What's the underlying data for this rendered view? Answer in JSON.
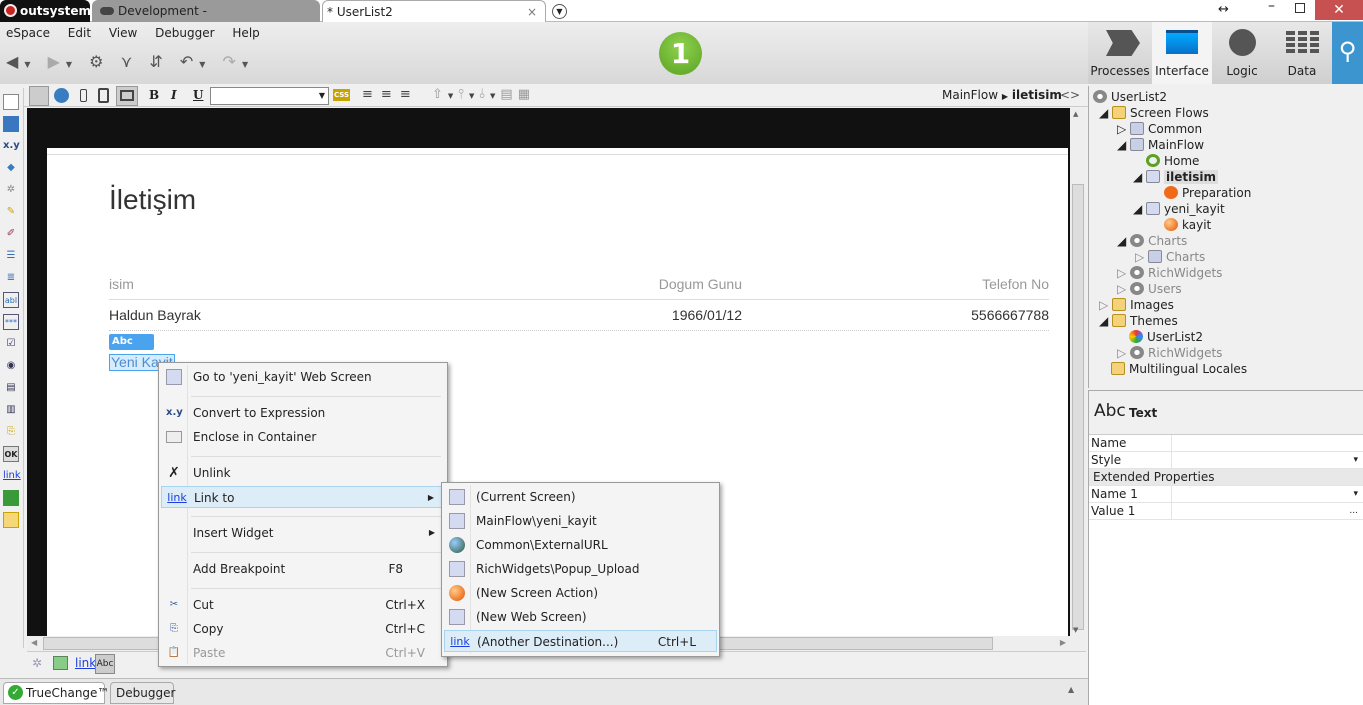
{
  "titlebar": {
    "brand": "outsystems",
    "tabs": [
      "Development - boa.outsystemscl...",
      "* UserList2"
    ],
    "close_tab": "×"
  },
  "menu": [
    "eSpace",
    "Edit",
    "View",
    "Debugger",
    "Help"
  ],
  "step_badge": "1",
  "right_tabs": [
    {
      "label": "Processes"
    },
    {
      "label": "Interface",
      "selected": true
    },
    {
      "label": "Logic"
    },
    {
      "label": "Data"
    }
  ],
  "canvas_toolbar": {
    "bold": "B",
    "italic": "I",
    "underline": "U",
    "css": "CSS",
    "style_value": "",
    "breadcrumb_flow": "MainFlow",
    "breadcrumb_screen": "iletisim",
    "toggle": "<>"
  },
  "left_toolbar": [
    "x.y",
    "abl",
    "OK",
    "link"
  ],
  "page": {
    "title": "İletişim",
    "table": {
      "headers": [
        "isim",
        "Dogum Gunu",
        "Telefon No"
      ],
      "rows": [
        [
          "Haldun Bayrak",
          "1966/01/12",
          "5566667788"
        ]
      ]
    },
    "widget_badge": "Abc Text",
    "link_text": "Yeni Kayit"
  },
  "context_menu": {
    "items": [
      {
        "label": "Go to 'yeni_kayit' Web Screen",
        "shortcut": ""
      },
      {
        "label": "Convert to Expression",
        "shortcut": ""
      },
      {
        "label": "Enclose in Container",
        "shortcut": ""
      },
      {
        "label": "Unlink",
        "shortcut": ""
      },
      {
        "label": "Link to",
        "shortcut": ""
      },
      {
        "label": "Insert Widget",
        "shortcut": ""
      },
      {
        "label": "Add Breakpoint",
        "shortcut": "F8"
      },
      {
        "label": "Cut",
        "shortcut": "Ctrl+X"
      },
      {
        "label": "Copy",
        "shortcut": "Ctrl+C"
      },
      {
        "label": "Paste",
        "shortcut": "Ctrl+V"
      }
    ],
    "xy_icon": "x.y",
    "link_icon": "link"
  },
  "submenu": {
    "items": [
      {
        "label": "(Current Screen)",
        "shortcut": ""
      },
      {
        "label": "MainFlow\\yeni_kayit",
        "shortcut": ""
      },
      {
        "label": "Common\\ExternalURL",
        "shortcut": ""
      },
      {
        "label": "RichWidgets\\Popup_Upload",
        "shortcut": ""
      },
      {
        "label": "(New Screen Action)",
        "shortcut": ""
      },
      {
        "label": "(New Web Screen)",
        "shortcut": ""
      },
      {
        "label": "(Another Destination...)",
        "shortcut": "Ctrl+L"
      }
    ]
  },
  "bottom_strip": {
    "link": "link",
    "abc": "Abc"
  },
  "bottom_tabs": [
    "TrueChange™",
    "Debugger"
  ],
  "tree": [
    "UserList2",
    "Screen Flows",
    "Common",
    "MainFlow",
    "Home",
    "iletisim",
    "Preparation",
    "yeni_kayit",
    "kayit",
    "Charts",
    "Charts",
    "RichWidgets",
    "Users",
    "Images",
    "Themes",
    "UserList2",
    "RichWidgets",
    "Multilingual Locales"
  ],
  "properties": {
    "header_icon": "Abc",
    "header": "Text",
    "rows": [
      {
        "name": "Name",
        "value": ""
      },
      {
        "name": "Style",
        "value": "▾"
      }
    ],
    "section": "Extended Properties",
    "ext_rows": [
      {
        "name": "Name 1",
        "value": "▾"
      },
      {
        "name": "Value 1",
        "value": "..."
      }
    ]
  },
  "colors": {
    "accent": "#3d95d0",
    "close": "#c75050",
    "badge_green": "#6cb52d",
    "selection": "#4aa3ef"
  }
}
